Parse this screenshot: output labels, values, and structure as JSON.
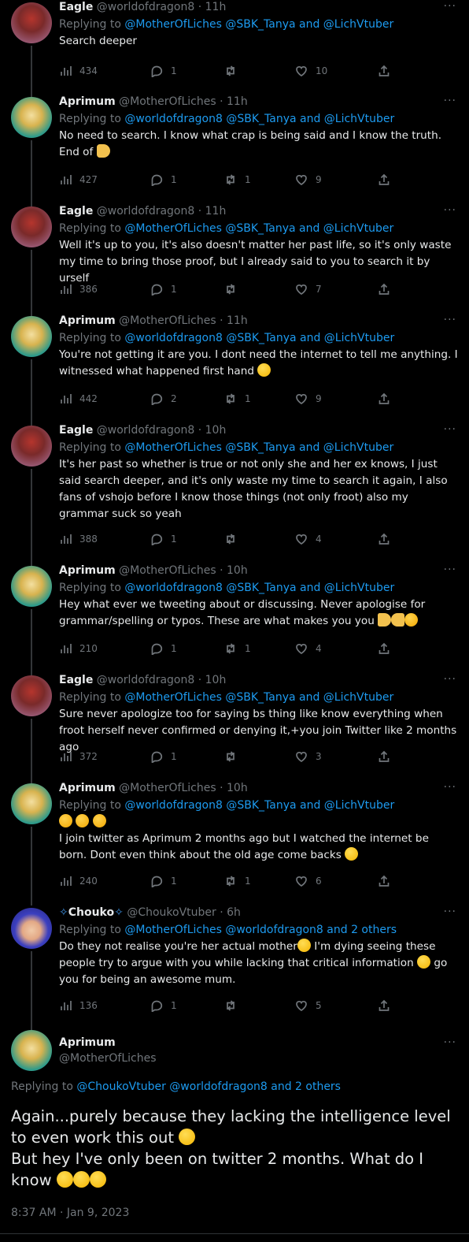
{
  "tweets": [
    {
      "name": "Eagle",
      "handle": "@worldofdragon8",
      "time": "11h",
      "reply_prefix": "Replying to",
      "reply_to": "@MotherOfLiches @SBK_Tanya and @LichVtuber",
      "text": "Search deeper",
      "views": "434",
      "replies": "1",
      "retweets": "",
      "likes": "10"
    },
    {
      "name": "Aprimum",
      "handle": "@MotherOfLiches",
      "time": "11h",
      "reply_prefix": "Replying to",
      "reply_to": "@worldofdragon8 @SBK_Tanya and @LichVtuber",
      "text": "No need to search. I know what crap is being said and I know the truth. End of",
      "views": "427",
      "replies": "1",
      "retweets": "1",
      "likes": "9"
    },
    {
      "name": "Eagle",
      "handle": "@worldofdragon8",
      "time": "11h",
      "reply_prefix": "Replying to",
      "reply_to": "@MotherOfLiches @SBK_Tanya and @LichVtuber",
      "text": "Well it's up to you, it's also doesn't matter her past life, so it's only waste my time to bring those proof, but I already said to you to search it by urself",
      "views": "386",
      "replies": "1",
      "retweets": "",
      "likes": "7"
    },
    {
      "name": "Aprimum",
      "handle": "@MotherOfLiches",
      "time": "11h",
      "reply_prefix": "Replying to",
      "reply_to": "@worldofdragon8 @SBK_Tanya and @LichVtuber",
      "text": "You're not getting it are you. I dont need the internet to tell me anything. I witnessed what happened first hand",
      "views": "442",
      "replies": "2",
      "retweets": "1",
      "likes": "9"
    },
    {
      "name": "Eagle",
      "handle": "@worldofdragon8",
      "time": "10h",
      "reply_prefix": "Replying to",
      "reply_to": "@MotherOfLiches @SBK_Tanya and @LichVtuber",
      "text": "It's her past so whether is true or not only she and her ex knows, I just said search deeper, and it's only waste my time to search it again, I also fans of vshojo before I know those things (not only froot) also my grammar suck so yeah",
      "views": "388",
      "replies": "1",
      "retweets": "",
      "likes": "4"
    },
    {
      "name": "Aprimum",
      "handle": "@MotherOfLiches",
      "time": "10h",
      "reply_prefix": "Replying to",
      "reply_to": "@worldofdragon8 @SBK_Tanya and @LichVtuber",
      "text": "Hey what ever we tweeting about or discussing. Never apologise for grammar/spelling or typos. These are what makes you you",
      "views": "210",
      "replies": "1",
      "retweets": "1",
      "likes": "4"
    },
    {
      "name": "Eagle",
      "handle": "@worldofdragon8",
      "time": "10h",
      "reply_prefix": "Replying to",
      "reply_to": "@MotherOfLiches @SBK_Tanya and @LichVtuber",
      "text": "Sure never apologize too for saying bs thing like know everything when froot herself never confirmed or denying it,+you join Twitter like 2 months ago",
      "views": "372",
      "replies": "1",
      "retweets": "",
      "likes": "3"
    },
    {
      "name": "Aprimum",
      "handle": "@MotherOfLiches",
      "time": "10h",
      "reply_prefix": "Replying to",
      "reply_to": "@worldofdragon8 @SBK_Tanya and @LichVtuber",
      "text": "I join twitter as Aprimum 2 months ago but I watched the internet be born. Dont even think about the old age come backs",
      "views": "240",
      "replies": "1",
      "retweets": "1",
      "likes": "6"
    },
    {
      "name": "Chouko",
      "handle": "@ChoukoVtuber",
      "time": "6h",
      "reply_prefix": "Replying to",
      "reply_to": "@MotherOfLiches @worldofdragon8 and 2 others",
      "text_a": "Do they not realise you're her actual mother",
      "text_b": " I'm dying seeing these people try to argue with you while lacking that critical information",
      "text_c": " go you for being an awesome mum.",
      "views": "136",
      "replies": "1",
      "retweets": "",
      "likes": "5"
    }
  ],
  "main": {
    "name": "Aprimum",
    "handle": "@MotherOfLiches",
    "reply_prefix": "Replying to",
    "reply_to": "@ChoukoVtuber @worldofdragon8 and 2 others",
    "line1": "Again...purely because they lacking the intelligence level to even work this out",
    "line2": "But hey  I've only been on twitter 2 months.  What do I know",
    "timestamp": "8:37 AM · Jan 9, 2023"
  },
  "ui": {
    "more": "···",
    "dot": "·"
  },
  "colors": {
    "link": "#1d9bf0",
    "muted": "#71767b",
    "background": "#000000",
    "text": "#e7e9ea"
  }
}
